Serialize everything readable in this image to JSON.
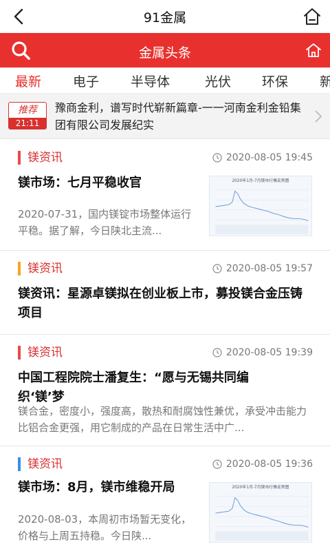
{
  "topbar": {
    "title": "91金属"
  },
  "header": {
    "title": "金属头条"
  },
  "tabs": [
    {
      "label": "最新",
      "active": true
    },
    {
      "label": "电子"
    },
    {
      "label": "半导体"
    },
    {
      "label": "光伏"
    },
    {
      "label": "环保"
    },
    {
      "label": "新"
    }
  ],
  "pinned": {
    "badge": "推荐",
    "time": "21:11",
    "text": "豫商金利，谱写时代崭新篇章-一一河南金利金铅集团有限公司发展纪实"
  },
  "articles": [
    {
      "category": "镁资讯",
      "category_color": "#e84a4a",
      "time": "2020-08-05 19:45",
      "title": "镁市场：七月平稳收官",
      "summary": "2020-07-31，国内镁锭市场整体运行平稳。据了解，今日陕北主流...",
      "thumb_caption": "2020年1月-7月镁市行情走势图"
    },
    {
      "category": "镁资讯",
      "category_color": "#f5a623",
      "time": "2020-08-05 19:57",
      "title": "镁资讯：星源卓镁拟在创业板上市，募投镁合金压铸项目"
    },
    {
      "category": "镁资讯",
      "category_color": "#e84a4a",
      "time": "2020-08-05 19:39",
      "title": "中国工程院院士潘复生：“愿与无锡共同编织‘镁’梦",
      "summary": "镁合金，密度小，强度高，散热和耐腐蚀性兼优，承受冲击能力比铝合金更强，用它制成的产品在日常生活中广..."
    },
    {
      "category": "镁资讯",
      "category_color": "#3a8ee6",
      "time": "2020-08-05 19:36",
      "title": "镁市场：8月，镁市维稳开局",
      "summary": "2020-08-03，本周初市场暂无变化，价格与上周五持稳。今日陕...",
      "thumb_caption": "2020年1月-7月镁市行情走势图"
    }
  ],
  "colors": {
    "brand": "#e8302e",
    "accent_text": "#d9302e"
  }
}
